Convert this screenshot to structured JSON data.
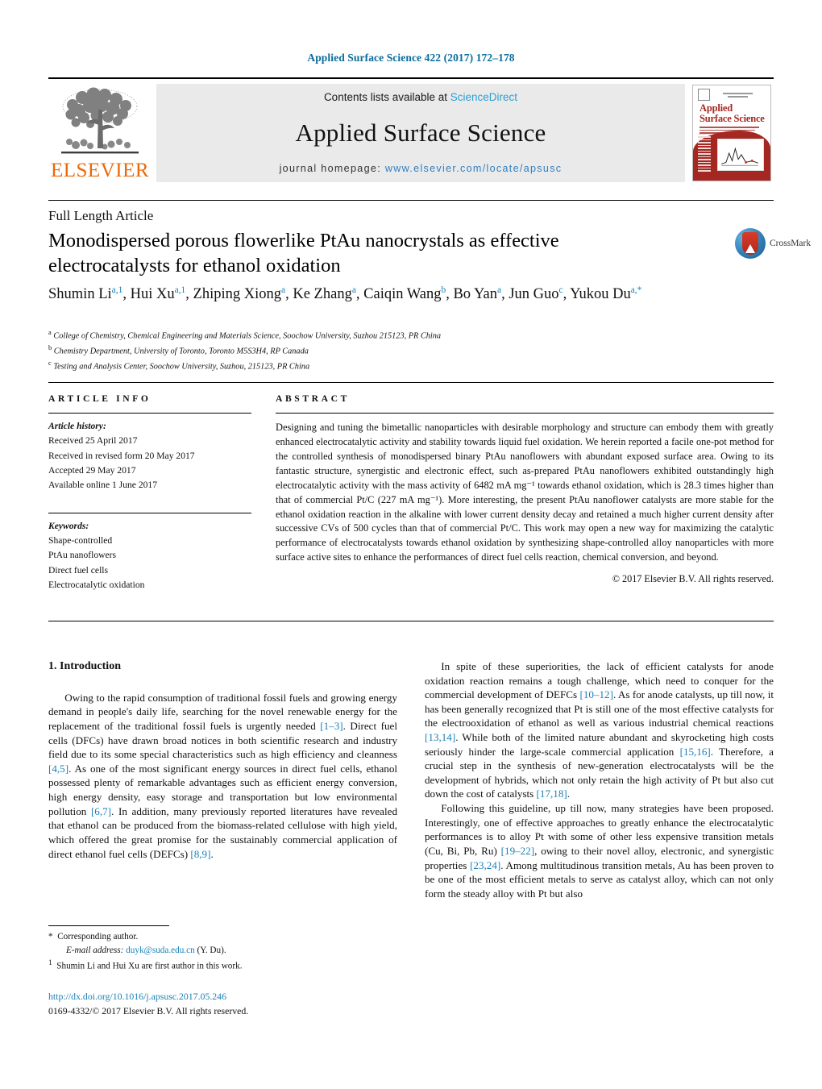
{
  "running_head": "Applied Surface Science 422 (2017) 172–178",
  "masthead": {
    "contents_prefix": "Contents lists available at ",
    "contents_link": "ScienceDirect",
    "journal_title": "Applied Surface Science",
    "homepage_prefix": "journal homepage: ",
    "homepage_url": "www.elsevier.com/locate/apsusc",
    "publisher": "ELSEVIER",
    "cover_title_line1": "Applied",
    "cover_title_line2": "Surface Science"
  },
  "article": {
    "type": "Full Length Article",
    "title": "Monodispersed porous flowerlike PtAu nanocrystals as effective electrocatalysts for ethanol oxidation",
    "crossmark_label": "CrossMark",
    "authors_html": "Shumin Li<sup>a,1</sup>, Hui Xu<sup>a,1</sup>, Zhiping Xiong<sup>a</sup>, Ke Zhang<sup>a</sup>, Caiqin Wang<sup>b</sup>, Bo Yan<sup>a</sup>, Jun Guo<sup>c</sup>, Yukou Du<sup>a,*</sup>",
    "affiliations": [
      {
        "mark": "a",
        "text": "College of Chemistry, Chemical Engineering and Materials Science, Soochow University, Suzhou 215123, PR China"
      },
      {
        "mark": "b",
        "text": "Chemistry Department, University of Toronto, Toronto M5S3H4, RP Canada"
      },
      {
        "mark": "c",
        "text": "Testing and Analysis Center, Soochow University, Suzhou, 215123, PR China"
      }
    ]
  },
  "article_info": {
    "heading": "ARTICLE INFO",
    "history_label": "Article history:",
    "history": [
      "Received 25 April 2017",
      "Received in revised form 20 May 2017",
      "Accepted 29 May 2017",
      "Available online 1 June 2017"
    ],
    "keywords_label": "Keywords:",
    "keywords": [
      "Shape-controlled",
      "PtAu nanoflowers",
      "Direct fuel cells",
      "Electrocatalytic oxidation"
    ]
  },
  "abstract": {
    "heading": "ABSTRACT",
    "text": "Designing and tuning the bimetallic nanoparticles with desirable morphology and structure can embody them with greatly enhanced electrocatalytic activity and stability towards liquid fuel oxidation. We herein reported a facile one-pot method for the controlled synthesis of monodispersed binary PtAu nanoflowers with abundant exposed surface area. Owing to its fantastic structure, synergistic and electronic effect, such as-prepared PtAu nanoflowers exhibited outstandingly high electrocatalytic activity with the mass activity of 6482 mA mg⁻¹ towards ethanol oxidation, which is 28.3 times higher than that of commercial Pt/C (227 mA mg⁻¹). More interesting, the present PtAu nanoflower catalysts are more stable for the ethanol oxidation reaction in the alkaline with lower current density decay and retained a much higher current density after successive CVs of 500 cycles than that of commercial Pt/C. This work may open a new way for maximizing the catalytic performance of electrocatalysts towards ethanol oxidation by synthesizing shape-controlled alloy nanoparticles with more surface active sites to enhance the performances of direct fuel cells reaction, chemical conversion, and beyond.",
    "copyright": "© 2017 Elsevier B.V. All rights reserved."
  },
  "introduction": {
    "heading": "1.  Introduction",
    "left_paragraphs_html": [
      "Owing to the rapid consumption of traditional fossil fuels and growing energy demand in people's daily life, searching for the novel renewable energy for the replacement of the traditional fossil fuels is urgently needed <span class=\"ref\">[1–3]</span>. Direct fuel cells (DFCs) have drawn broad notices in both scientific research and industry field due to its some special characteristics such as high efficiency and cleanness <span class=\"ref\">[4,5]</span>. As one of the most significant energy sources in direct fuel cells, ethanol possessed plenty of remarkable advantages such as efficient energy conversion, high energy density, easy storage and transportation but low environmental pollution <span class=\"ref\">[6,7]</span>. In addition, many previously reported literatures have revealed that ethanol can be produced from the biomass-related cellulose with high yield, which offered the great promise for the sustainably commercial application of direct ethanol fuel cells (DEFCs) <span class=\"ref\">[8,9]</span>."
    ],
    "right_paragraphs_html": [
      "In spite of these superiorities, the lack of efficient catalysts for anode oxidation reaction remains a tough challenge, which need to conquer for the commercial development of DEFCs <span class=\"ref\">[10–12]</span>. As for anode catalysts, up till now, it has been generally recognized that Pt is still one of the most effective catalysts for the electrooxidation of ethanol as well as various industrial chemical reactions <span class=\"ref\">[13,14]</span>. While both of the limited nature abundant and skyrocketing high costs seriously hinder the large-scale commercial application <span class=\"ref\">[15,16]</span>. Therefore, a crucial step in the synthesis of new-generation electrocatalysts will be the development of hybrids, which not only retain the high activity of Pt but also cut down the cost of catalysts <span class=\"ref\">[17,18]</span>.",
      "Following this guideline, up till now, many strategies have been proposed. Interestingly, one of effective approaches to greatly enhance the electrocatalytic performances is to alloy Pt with some of other less expensive transition metals (Cu, Bi, Pb, Ru) <span class=\"ref\">[19–22]</span>, owing to their novel alloy, electronic, and synergistic properties <span class=\"ref\">[23,24]</span>. Among multitudinous transition metals, Au has been proven to be one of the most efficient metals to serve as catalyst alloy, which can not only form the steady alloy with Pt but also"
    ]
  },
  "footnotes": {
    "corresponding": "Corresponding author.",
    "email_label": "E-mail address:",
    "email": "duyk@suda.edu.cn",
    "email_suffix": "(Y. Du).",
    "first_author_note": "Shumin Li and Hui Xu are first author in this work."
  },
  "doi_block": {
    "doi": "http://dx.doi.org/10.1016/j.apsusc.2017.05.246",
    "issn_line": "0169-4332/© 2017 Elsevier B.V. All rights reserved."
  },
  "colors": {
    "link": "#1a7fb8",
    "running_head": "#0b6c9c",
    "elsevier_orange": "#ec6707",
    "cover_red": "#a42722"
  }
}
